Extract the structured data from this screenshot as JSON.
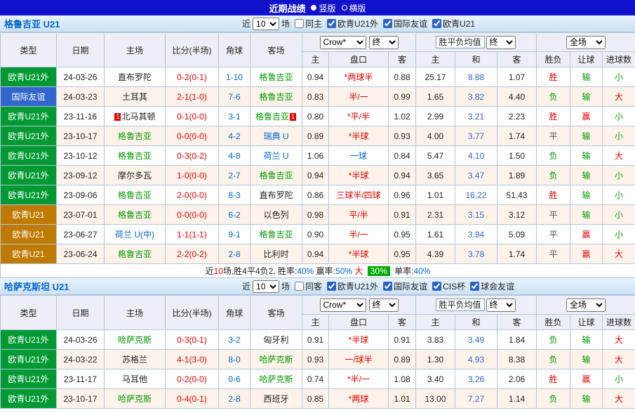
{
  "topbar": {
    "title": "近期战绩",
    "layout_options": [
      {
        "label": "竖版",
        "selected": true
      },
      {
        "label": "横版",
        "selected": false
      }
    ]
  },
  "colors": {
    "topbar_bg": "#1212CC",
    "section_title": "#0066CC",
    "grid_border": "#B2C6DC",
    "header_bg": "#EEEEF6",
    "alt_row_bg": "#FDF3EA",
    "type_colors": {
      "green": "#009933",
      "blue": "#3366CC",
      "orange": "#BF7A00"
    },
    "team_colors": {
      "focus": "#009900",
      "link": "#0066CC",
      "plain": "#222222"
    },
    "handicap_colors": {
      "red": "#E60000",
      "blue": "#0066CC"
    },
    "score_color": "#E60000",
    "corner_color": "#0066CC",
    "avg_mid_color": "#3366CC",
    "result_map": {
      "胜": "#E60000",
      "负": "#009900",
      "平": "#555555",
      "输": "#009900",
      "赢": "#E60000",
      "大": "#E60000",
      "小": "#009900"
    },
    "badge_bg": "#00AA00"
  },
  "table_header": {
    "main_cols": [
      "类型",
      "日期",
      "主场",
      "比分(半场)",
      "角球",
      "客场"
    ],
    "odds_company": "Crow*",
    "final_label": "终",
    "avg_label": "胜平负均值",
    "scope_label": "全场",
    "sub_cols": [
      "主",
      "盘口",
      "客",
      "主",
      "和",
      "客",
      "胜负",
      "让球",
      "进球数"
    ]
  },
  "sections": [
    {
      "team_title": "格鲁吉亚 U21",
      "near_label": "近",
      "recent_count": "10",
      "games_label": "场",
      "filters": [
        {
          "label": "同主",
          "checked": false
        },
        {
          "label": "欧青U21外",
          "checked": true
        },
        {
          "label": "国际友谊",
          "checked": true
        },
        {
          "label": "欧青U21",
          "checked": true
        }
      ],
      "rows": [
        {
          "type": "欧青U21外",
          "type_color": "green",
          "date": "24-03-26",
          "home": "直布罗陀",
          "home_style": "plain",
          "home_badge": "",
          "score": "0-2(0-1)",
          "corners": "1-10",
          "away": "格鲁吉亚",
          "away_style": "focus",
          "away_badge": "",
          "odds_home": "0.94",
          "handicap": "*两球半",
          "handicap_style": "red",
          "odds_away": "0.88",
          "avg_home": "25.17",
          "avg_draw": "8.88",
          "avg_away": "1.07",
          "result": "胜",
          "handicap_result": "输",
          "goals_result": "小"
        },
        {
          "type": "国际友谊",
          "type_color": "blue",
          "date": "24-03-23",
          "home": "土耳其",
          "home_style": "plain",
          "home_badge": "",
          "score": "2-1(1-0)",
          "corners": "7-6",
          "away": "格鲁吉亚",
          "away_style": "focus",
          "away_badge": "",
          "odds_home": "0.83",
          "handicap": "半/一",
          "handicap_style": "red",
          "odds_away": "0.99",
          "avg_home": "1.65",
          "avg_draw": "3.82",
          "avg_away": "4.40",
          "result": "负",
          "handicap_result": "输",
          "goals_result": "大"
        },
        {
          "type": "欧青U21外",
          "type_color": "green",
          "date": "23-11-16",
          "home": "北马其顿",
          "home_style": "plain",
          "home_badge": "1",
          "score": "0-1(0-0)",
          "corners": "3-1",
          "away": "格鲁吉亚",
          "away_style": "focus",
          "away_badge": "1",
          "odds_home": "0.80",
          "handicap": "*平/半",
          "handicap_style": "red",
          "odds_away": "1.02",
          "avg_home": "2.99",
          "avg_draw": "3.21",
          "avg_away": "2.23",
          "result": "胜",
          "handicap_result": "赢",
          "goals_result": "小"
        },
        {
          "type": "欧青U21外",
          "type_color": "green",
          "date": "23-10-17",
          "home": "格鲁吉亚",
          "home_style": "focus",
          "home_badge": "",
          "score": "0-0(0-0)",
          "corners": "4-2",
          "away": "瑞典 U",
          "away_style": "link",
          "away_badge": "",
          "odds_home": "0.89",
          "handicap": "*半球",
          "handicap_style": "red",
          "odds_away": "0.93",
          "avg_home": "4.00",
          "avg_draw": "3.77",
          "avg_away": "1.74",
          "result": "平",
          "handicap_result": "输",
          "goals_result": "小"
        },
        {
          "type": "欧青U21外",
          "type_color": "green",
          "date": "23-10-12",
          "home": "格鲁吉亚",
          "home_style": "focus",
          "home_badge": "",
          "score": "0-3(0-2)",
          "corners": "4-8",
          "away": "荷兰 U",
          "away_style": "link",
          "away_badge": "",
          "odds_home": "1.06",
          "handicap": "一球",
          "handicap_style": "blue",
          "odds_away": "0.84",
          "avg_home": "5.47",
          "avg_draw": "4.10",
          "avg_away": "1.50",
          "result": "负",
          "handicap_result": "输",
          "goals_result": "大"
        },
        {
          "type": "欧青U21外",
          "type_color": "green",
          "date": "23-09-12",
          "home": "摩尔多瓦",
          "home_style": "plain",
          "home_badge": "",
          "score": "1-0(0-0)",
          "corners": "2-7",
          "away": "格鲁吉亚",
          "away_style": "focus",
          "away_badge": "",
          "odds_home": "0.94",
          "handicap": "*半球",
          "handicap_style": "red",
          "odds_away": "0.94",
          "avg_home": "3.65",
          "avg_draw": "3.47",
          "avg_away": "1.89",
          "result": "负",
          "handicap_result": "输",
          "goals_result": "小"
        },
        {
          "type": "欧青U21外",
          "type_color": "green",
          "date": "23-09-06",
          "home": "格鲁吉亚",
          "home_style": "focus",
          "home_badge": "",
          "score": "2-0(0-0)",
          "corners": "8-3",
          "away": "直布罗陀",
          "away_style": "plain",
          "away_badge": "",
          "odds_home": "0.86",
          "handicap": "三球半/四球",
          "handicap_style": "red",
          "odds_away": "0.96",
          "avg_home": "1.01",
          "avg_draw": "16.22",
          "avg_away": "51.43",
          "result": "胜",
          "handicap_result": "输",
          "goals_result": "小"
        },
        {
          "type": "欧青U21",
          "type_color": "orange",
          "date": "23-07-01",
          "home": "格鲁吉亚",
          "home_style": "focus",
          "home_badge": "",
          "score": "0-0(0-0)",
          "corners": "6-2",
          "away": "以色列",
          "away_style": "plain",
          "away_badge": "",
          "odds_home": "0.98",
          "handicap": "平/半",
          "handicap_style": "red",
          "odds_away": "0.91",
          "avg_home": "2.31",
          "avg_draw": "3.15",
          "avg_away": "3.12",
          "result": "平",
          "handicap_result": "输",
          "goals_result": "小"
        },
        {
          "type": "欧青U21",
          "type_color": "orange",
          "date": "23-06-27",
          "home": "荷兰 U(中)",
          "home_style": "link",
          "home_badge": "",
          "score": "1-1(1-1)",
          "corners": "9-1",
          "away": "格鲁吉亚",
          "away_style": "focus",
          "away_badge": "",
          "odds_home": "0.90",
          "handicap": "半/一",
          "handicap_style": "red",
          "odds_away": "0.95",
          "avg_home": "1.61",
          "avg_draw": "3.94",
          "avg_away": "5.09",
          "result": "平",
          "handicap_result": "赢",
          "goals_result": "小"
        },
        {
          "type": "欧青U21",
          "type_color": "orange",
          "date": "23-06-24",
          "home": "格鲁吉亚",
          "home_style": "focus",
          "home_badge": "",
          "score": "2-2(0-2)",
          "corners": "2-8",
          "away": "比利时",
          "away_style": "plain",
          "away_badge": "",
          "odds_home": "0.94",
          "handicap": "*半球",
          "handicap_style": "red",
          "odds_away": "0.95",
          "avg_home": "4.39",
          "avg_draw": "3.78",
          "avg_away": "1.74",
          "result": "平",
          "handicap_result": "赢",
          "goals_result": "大"
        }
      ],
      "summary": [
        {
          "text": "近",
          "style": "plain"
        },
        {
          "text": "10",
          "style": "red"
        },
        {
          "text": "场,胜4平4负2, 胜率:",
          "style": "plain"
        },
        {
          "text": "40%",
          "style": "blue"
        },
        {
          "text": " 赢率:",
          "style": "plain"
        },
        {
          "text": "50%",
          "style": "blue"
        },
        {
          "text": " 大 ",
          "style": "red"
        },
        {
          "text": "30%",
          "style": "badge"
        },
        {
          "text": " 单率:",
          "style": "plain"
        },
        {
          "text": "40%",
          "style": "blue"
        }
      ]
    },
    {
      "team_title": "哈萨克斯坦 U21",
      "near_label": "近",
      "recent_count": "10",
      "games_label": "场",
      "filters": [
        {
          "label": "同客",
          "checked": false
        },
        {
          "label": "欧青U21外",
          "checked": true
        },
        {
          "label": "国际友谊",
          "checked": true
        },
        {
          "label": "CIS杯",
          "checked": true
        },
        {
          "label": "球会友谊",
          "checked": true
        }
      ],
      "rows": [
        {
          "type": "欧青U21外",
          "type_color": "green",
          "date": "24-03-26",
          "home": "哈萨克斯",
          "home_style": "focus",
          "home_badge": "",
          "score": "0-3(0-1)",
          "corners": "3-2",
          "away": "匈牙利",
          "away_style": "plain",
          "away_badge": "",
          "odds_home": "0.91",
          "handicap": "*半球",
          "handicap_style": "red",
          "odds_away": "0.91",
          "avg_home": "3.83",
          "avg_draw": "3.49",
          "avg_away": "1.84",
          "result": "负",
          "handicap_result": "输",
          "goals_result": "大"
        },
        {
          "type": "欧青U21外",
          "type_color": "green",
          "date": "24-03-22",
          "home": "苏格兰",
          "home_style": "plain",
          "home_badge": "",
          "score": "4-1(3-0)",
          "corners": "8-0",
          "away": "哈萨克斯",
          "away_style": "focus",
          "away_badge": "",
          "odds_home": "0.93",
          "handicap": "一/球半",
          "handicap_style": "red",
          "odds_away": "0.89",
          "avg_home": "1.30",
          "avg_draw": "4.93",
          "avg_away": "8.38",
          "result": "负",
          "handicap_result": "输",
          "goals_result": "大"
        },
        {
          "type": "欧青U21外",
          "type_color": "green",
          "date": "23-11-17",
          "home": "马耳他",
          "home_style": "plain",
          "home_badge": "",
          "score": "0-2(0-0)",
          "corners": "0-6",
          "away": "哈萨克斯",
          "away_style": "focus",
          "away_badge": "",
          "odds_home": "0.74",
          "handicap": "*半/一",
          "handicap_style": "red",
          "odds_away": "1.08",
          "avg_home": "3.40",
          "avg_draw": "3.26",
          "avg_away": "2.06",
          "result": "胜",
          "handicap_result": "赢",
          "goals_result": "小"
        },
        {
          "type": "欧青U21外",
          "type_color": "green",
          "date": "23-10-17",
          "home": "哈萨克斯",
          "home_style": "focus",
          "home_badge": "",
          "score": "0-4(0-1)",
          "corners": "2-8",
          "away": "西班牙",
          "away_style": "plain",
          "away_badge": "",
          "odds_home": "0.85",
          "handicap": "*两球",
          "handicap_style": "red",
          "odds_away": "1.01",
          "avg_home": "13.00",
          "avg_draw": "7.27",
          "avg_away": "1.14",
          "result": "负",
          "handicap_result": "输",
          "goals_result": "大"
        }
      ],
      "summary": null
    }
  ]
}
